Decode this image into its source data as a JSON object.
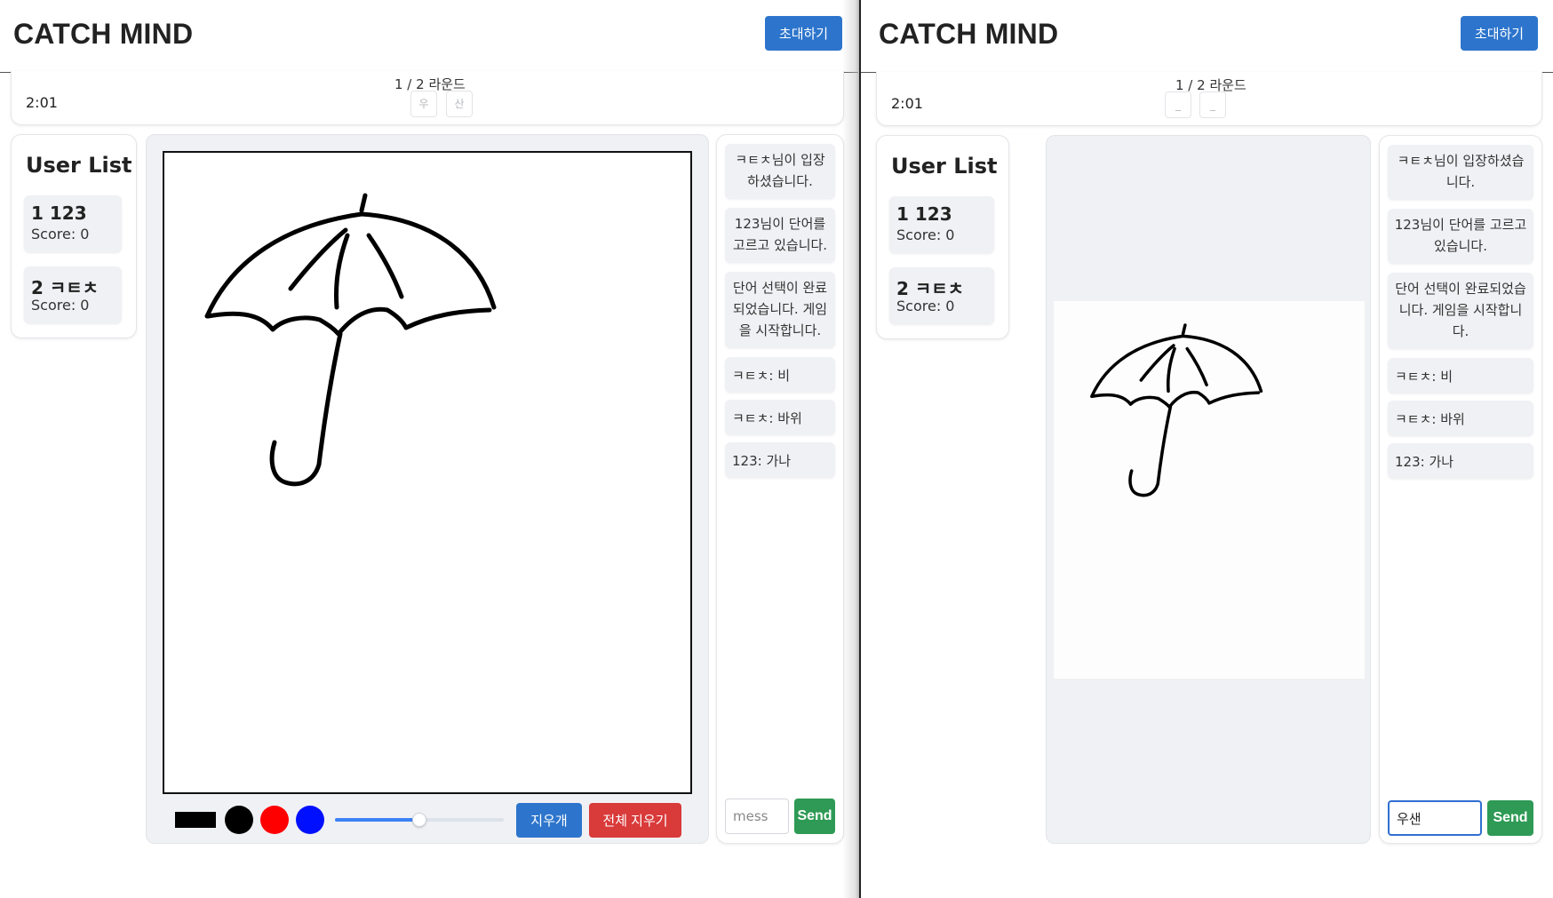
{
  "colors": {
    "primary": "#2d75cc",
    "danger": "#d93a3a",
    "success": "#2e9a55",
    "red": "#ff0000",
    "blue": "#0010ff",
    "black": "#000000"
  },
  "left": {
    "logo": "CATCH MIND",
    "invite_label": "초대하기",
    "round": "1 / 2 라운드",
    "timer": "2:01",
    "word_chips": [
      "우",
      "산"
    ],
    "user_list": {
      "title": "User List",
      "users": [
        {
          "name": "1 123",
          "score": "Score: 0"
        },
        {
          "name": "2 ㅋㅌㅊ",
          "score": "Score: 0"
        }
      ]
    },
    "tools": {
      "eraser_label": "지우개",
      "clear_label": "전체 지우기",
      "colors": [
        "black",
        "red",
        "blue"
      ],
      "brush_size_percent": 50
    },
    "chat": {
      "messages": [
        "ㅋㅌㅊ님이 입장하셨습니다.",
        "123님이 단어를 고르고 있습니다.",
        "단어 선택이 완료되었습니다. 게임을 시작합니다.",
        "ㅋㅌㅊ: 비",
        "ㅋㅌㅊ: 바위",
        "123: 가나"
      ],
      "input_placeholder": "mess",
      "input_value": "",
      "send_label": "Send"
    }
  },
  "right": {
    "logo": "CATCH MIND",
    "invite_label": "초대하기",
    "round": "1 / 2 라운드",
    "timer": "2:01",
    "word_chips": [
      "_",
      "_"
    ],
    "user_list": {
      "title": "User List",
      "users": [
        {
          "name": "1 123",
          "score": "Score: 0"
        },
        {
          "name": "2 ㅋㅌㅊ",
          "score": "Score: 0"
        }
      ]
    },
    "chat": {
      "messages": [
        "ㅋㅌㅊ님이 입장하셨습니다.",
        "123님이 단어를 고르고 있습니다.",
        "단어 선택이 완료되었습니다. 게임을 시작합니다.",
        "ㅋㅌㅊ: 비",
        "ㅋㅌㅊ: 바위",
        "123: 가나"
      ],
      "input_value": "우샌",
      "send_label": "Send"
    }
  }
}
